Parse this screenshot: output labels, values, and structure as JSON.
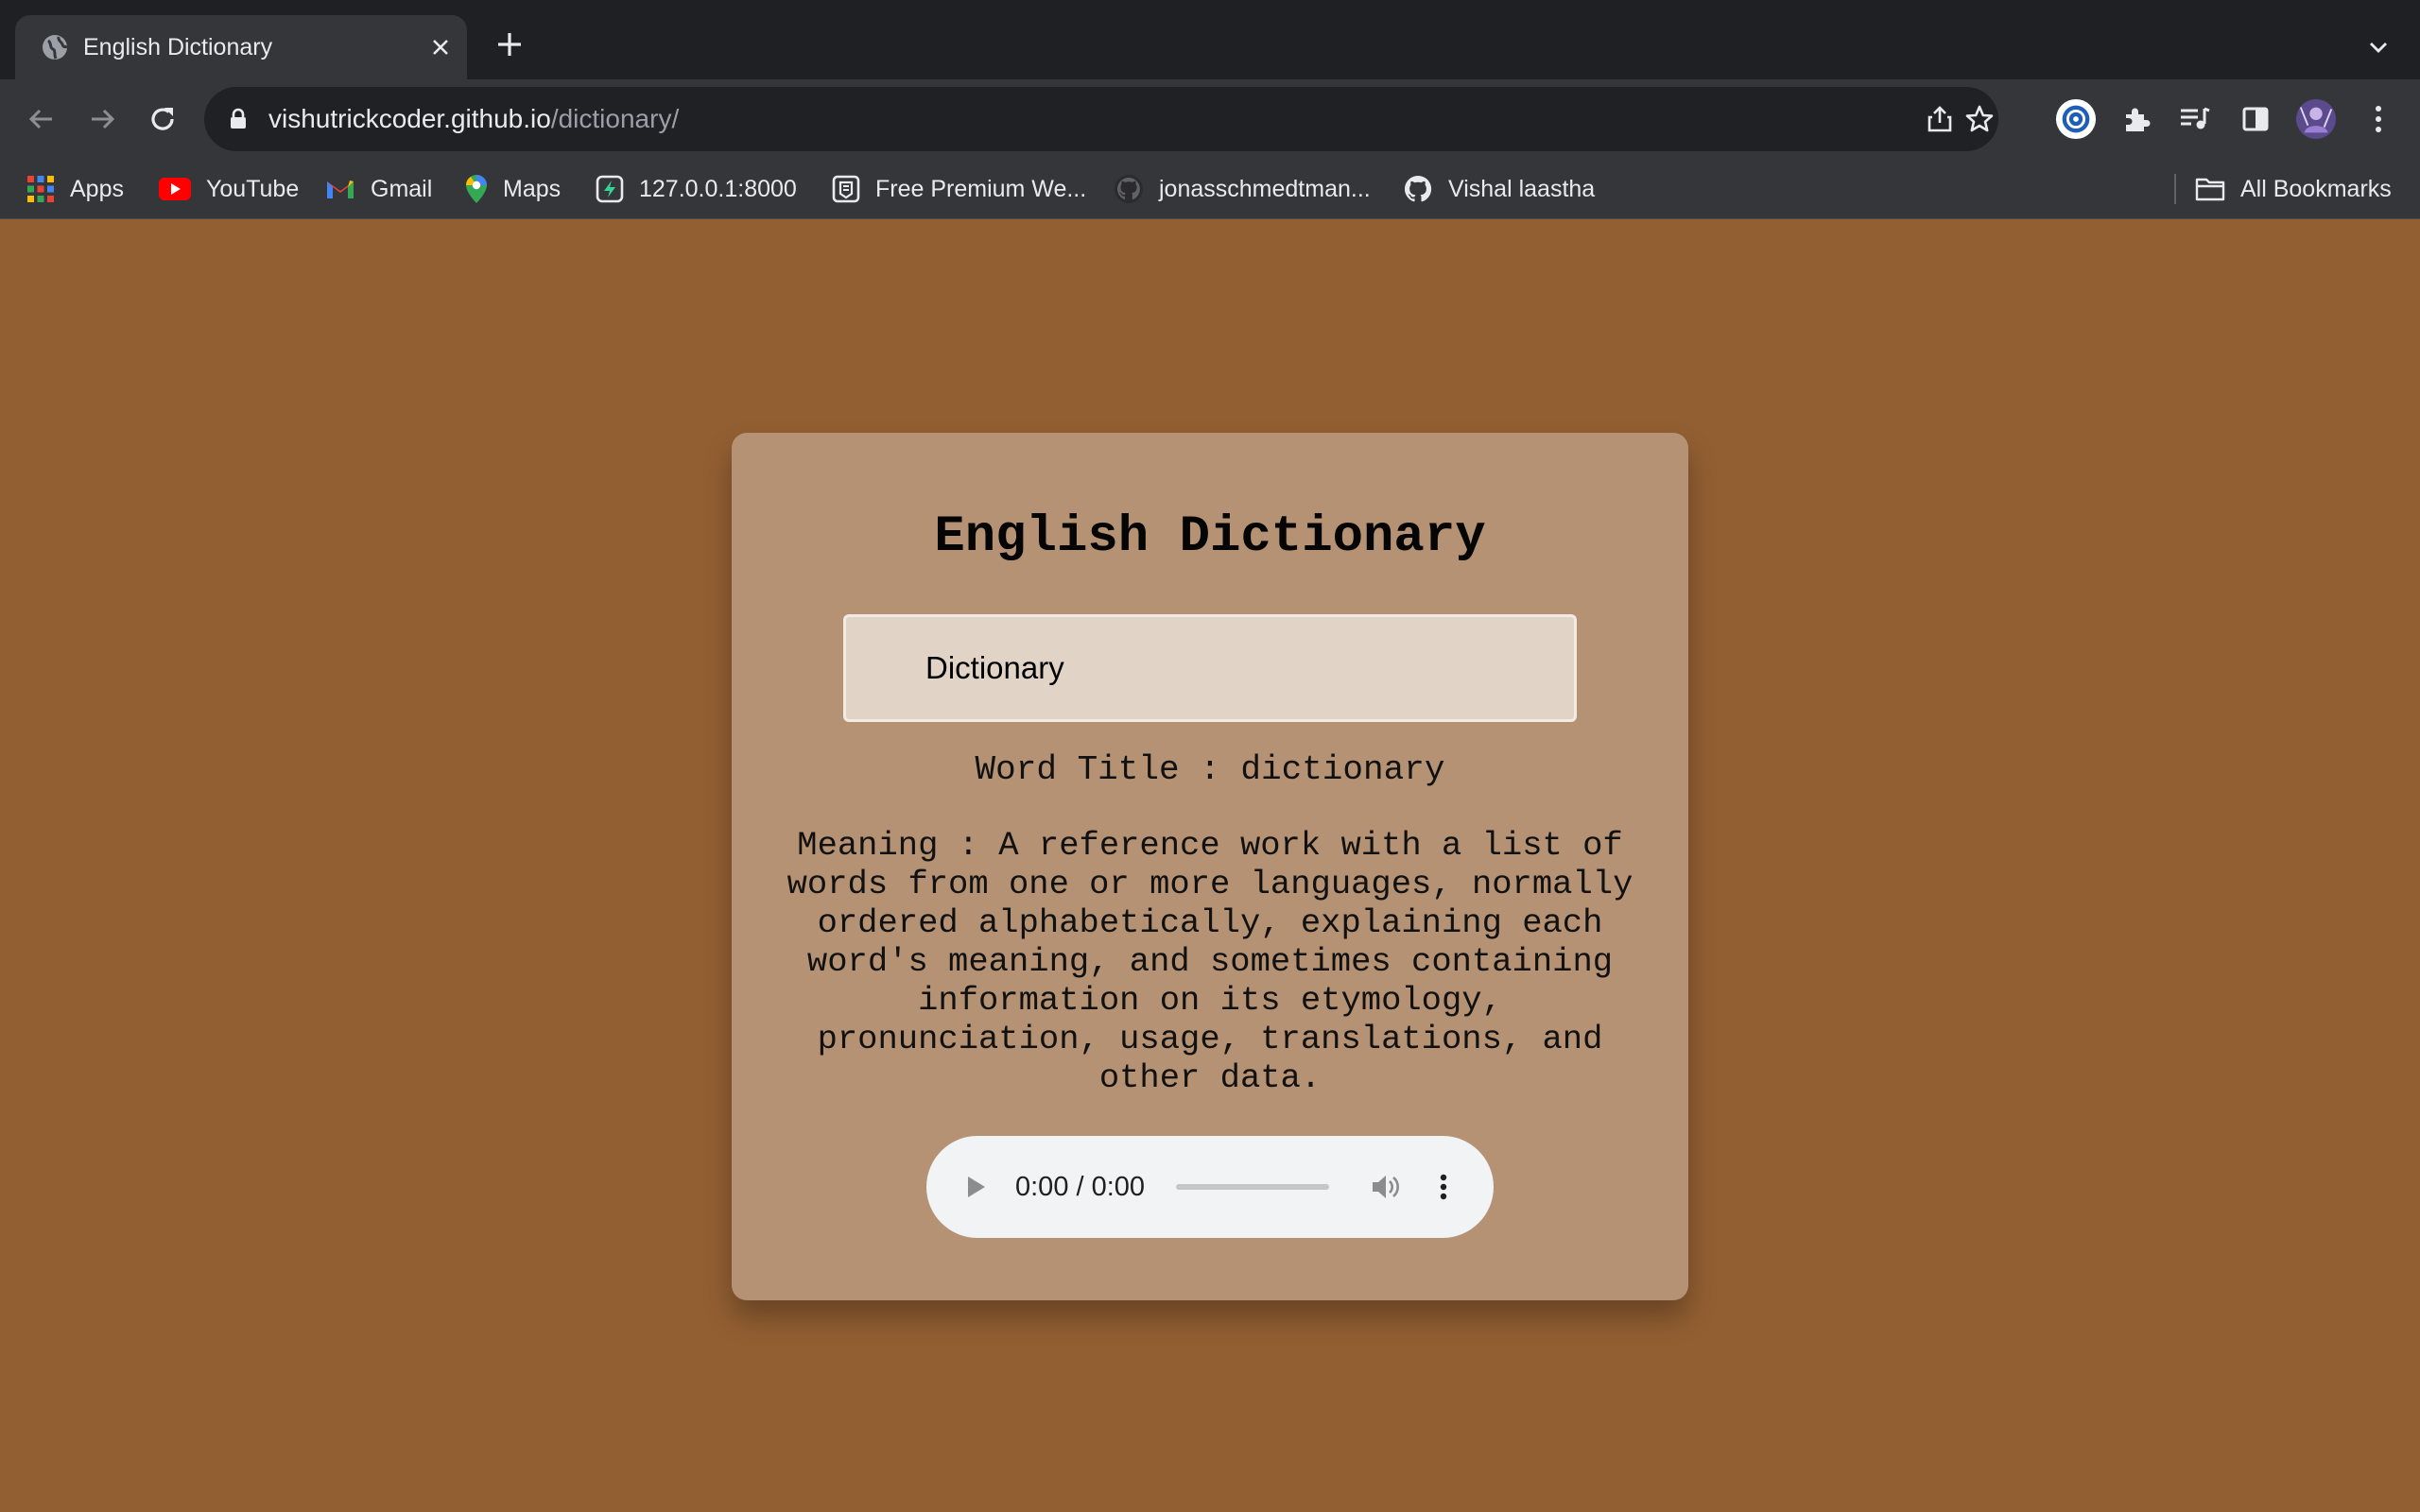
{
  "browser": {
    "tab": {
      "title": "English Dictionary"
    },
    "url": {
      "host": "vishutrickcoder.github.io",
      "path": "/dictionary/"
    },
    "bookmarks": [
      {
        "label": "Apps",
        "icon": "apps-grid-icon"
      },
      {
        "label": "YouTube",
        "icon": "youtube-icon"
      },
      {
        "label": "Gmail",
        "icon": "gmail-icon"
      },
      {
        "label": "Maps",
        "icon": "maps-icon"
      },
      {
        "label": "127.0.0.1:8000",
        "icon": "bolt-icon"
      },
      {
        "label": "Free Premium We...",
        "icon": "page-icon"
      },
      {
        "label": "jonasschmedtman...",
        "icon": "github-icon"
      },
      {
        "label": "Vishal laastha",
        "icon": "github-icon"
      }
    ],
    "all_bookmarks": "All Bookmarks"
  },
  "page": {
    "heading": "English Dictionary",
    "search": {
      "value": "Dictionary"
    },
    "word_title": "Word Title : dictionary",
    "meaning": "Meaning : A reference work with a list of words from one or more languages, normally ordered alphabetically, explaining each word's meaning, and sometimes containing information on its etymology, pronunciation, usage, translations, and other data.",
    "audio": {
      "time": "0:00 / 0:00",
      "progress": 0
    }
  },
  "colors": {
    "page_background": "#925f32",
    "card_background": "#b59273",
    "input_background": "#e1d3c6"
  }
}
